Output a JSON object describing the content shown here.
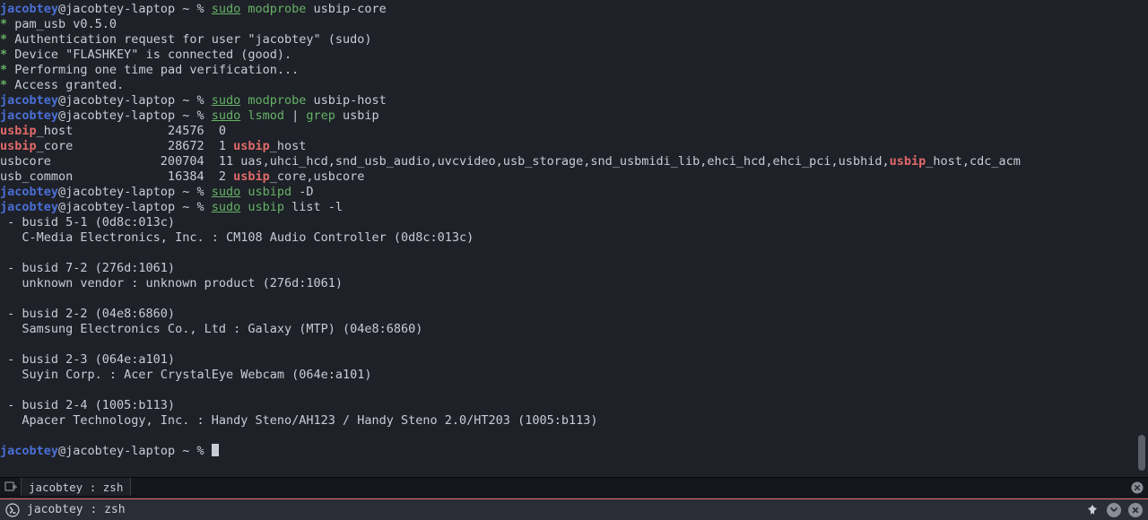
{
  "prompt": {
    "user": "jacobtey",
    "host": "@jacobtey-laptop ~ % "
  },
  "lines": [
    {
      "type": "prompt",
      "cmd": [
        {
          "t": "sudo",
          "c": "sudo"
        },
        {
          "t": " "
        },
        {
          "t": "modprobe",
          "c": "cmd"
        },
        {
          "t": " usbip-core"
        }
      ]
    },
    {
      "type": "star",
      "text": " pam_usb v0.5.0"
    },
    {
      "type": "star",
      "text": " Authentication request for user \"jacobtey\" (sudo)"
    },
    {
      "type": "star",
      "text": " Device \"FLASHKEY\" is connected (good)."
    },
    {
      "type": "star",
      "text": " Performing one time pad verification..."
    },
    {
      "type": "star",
      "text": " Access granted."
    },
    {
      "type": "prompt",
      "cmd": [
        {
          "t": "sudo",
          "c": "sudo"
        },
        {
          "t": " "
        },
        {
          "t": "modprobe",
          "c": "cmd"
        },
        {
          "t": " usbip-host"
        }
      ]
    },
    {
      "type": "prompt",
      "cmd": [
        {
          "t": "sudo",
          "c": "sudo"
        },
        {
          "t": " "
        },
        {
          "t": "lsmod",
          "c": "cmd"
        },
        {
          "t": " | "
        },
        {
          "t": "grep",
          "c": "cmd"
        },
        {
          "t": " usbip"
        }
      ]
    },
    {
      "type": "out",
      "frags": [
        {
          "t": "usbip",
          "c": "hl"
        },
        {
          "t": "_host             24576  0"
        }
      ]
    },
    {
      "type": "out",
      "frags": [
        {
          "t": "usbip",
          "c": "hl"
        },
        {
          "t": "_core             28672  1 "
        },
        {
          "t": "usbip",
          "c": "hl"
        },
        {
          "t": "_host"
        }
      ]
    },
    {
      "type": "out",
      "frags": [
        {
          "t": "usbcore               200704  11 uas,uhci_hcd,snd_usb_audio,uvcvideo,usb_storage,snd_usbmidi_lib,ehci_hcd,ehci_pci,usbhid,"
        },
        {
          "t": "usbip",
          "c": "hl"
        },
        {
          "t": "_host,cdc_acm"
        }
      ]
    },
    {
      "type": "out",
      "frags": [
        {
          "t": "usb_common             16384  2 "
        },
        {
          "t": "usbip",
          "c": "hl"
        },
        {
          "t": "_core,usbcore"
        }
      ]
    },
    {
      "type": "prompt",
      "cmd": [
        {
          "t": "sudo",
          "c": "sudo"
        },
        {
          "t": " "
        },
        {
          "t": "usbipd",
          "c": "cmd"
        },
        {
          "t": " -D"
        }
      ]
    },
    {
      "type": "prompt",
      "cmd": [
        {
          "t": "sudo",
          "c": "sudo"
        },
        {
          "t": " "
        },
        {
          "t": "usbip",
          "c": "cmd"
        },
        {
          "t": " list -l"
        }
      ]
    },
    {
      "type": "out",
      "frags": [
        {
          "t": " - busid 5-1 (0d8c:013c)"
        }
      ]
    },
    {
      "type": "out",
      "frags": [
        {
          "t": "   C-Media Electronics, Inc. : CM108 Audio Controller (0d8c:013c)"
        }
      ]
    },
    {
      "type": "blank"
    },
    {
      "type": "out",
      "frags": [
        {
          "t": " - busid 7-2 (276d:1061)"
        }
      ]
    },
    {
      "type": "out",
      "frags": [
        {
          "t": "   unknown vendor : unknown product (276d:1061)"
        }
      ]
    },
    {
      "type": "blank"
    },
    {
      "type": "out",
      "frags": [
        {
          "t": " - busid 2-2 (04e8:6860)"
        }
      ]
    },
    {
      "type": "out",
      "frags": [
        {
          "t": "   Samsung Electronics Co., Ltd : Galaxy (MTP) (04e8:6860)"
        }
      ]
    },
    {
      "type": "blank"
    },
    {
      "type": "out",
      "frags": [
        {
          "t": " - busid 2-3 (064e:a101)"
        }
      ]
    },
    {
      "type": "out",
      "frags": [
        {
          "t": "   Suyin Corp. : Acer CrystalEye Webcam (064e:a101)"
        }
      ]
    },
    {
      "type": "blank"
    },
    {
      "type": "out",
      "frags": [
        {
          "t": " - busid 2-4 (1005:b113)"
        }
      ]
    },
    {
      "type": "out",
      "frags": [
        {
          "t": "   Apacer Technology, Inc. : Handy Steno/AH123 / Handy Steno 2.0/HT203 (1005:b113)"
        }
      ]
    },
    {
      "type": "blank"
    },
    {
      "type": "prompt",
      "cmd": [],
      "cursor": true
    }
  ],
  "tabbar": {
    "tab_label": "jacobtey : zsh"
  },
  "statusbar": {
    "label": "jacobtey : zsh"
  }
}
